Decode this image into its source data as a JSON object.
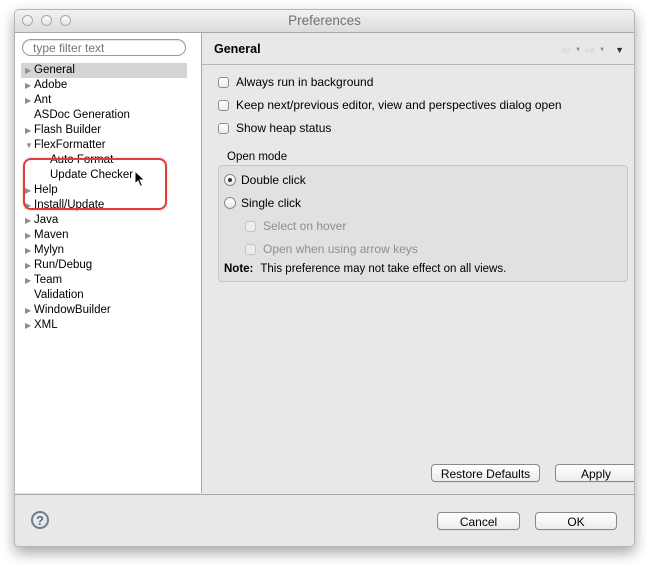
{
  "window": {
    "title": "Preferences"
  },
  "sidebar": {
    "filter": {
      "placeholder": "type filter text",
      "value": ""
    },
    "items": [
      {
        "label": "General",
        "expandable": true,
        "expanded": false,
        "selected": true,
        "level": 0
      },
      {
        "label": "Adobe",
        "expandable": true,
        "expanded": false,
        "level": 0
      },
      {
        "label": "Ant",
        "expandable": true,
        "expanded": false,
        "level": 0
      },
      {
        "label": "ASDoc Generation",
        "expandable": false,
        "level": 0
      },
      {
        "label": "Flash Builder",
        "expandable": true,
        "expanded": false,
        "level": 0
      },
      {
        "label": "FlexFormatter",
        "expandable": true,
        "expanded": true,
        "level": 0
      },
      {
        "label": "Auto Format",
        "expandable": false,
        "level": 1
      },
      {
        "label": "Update Checker",
        "expandable": false,
        "level": 1
      },
      {
        "label": "Help",
        "expandable": true,
        "expanded": false,
        "level": 0
      },
      {
        "label": "Install/Update",
        "expandable": true,
        "expanded": false,
        "level": 0
      },
      {
        "label": "Java",
        "expandable": true,
        "expanded": false,
        "level": 0
      },
      {
        "label": "Maven",
        "expandable": true,
        "expanded": false,
        "level": 0
      },
      {
        "label": "Mylyn",
        "expandable": true,
        "expanded": false,
        "level": 0
      },
      {
        "label": "Run/Debug",
        "expandable": true,
        "expanded": false,
        "level": 0
      },
      {
        "label": "Team",
        "expandable": true,
        "expanded": false,
        "level": 0
      },
      {
        "label": "Validation",
        "expandable": false,
        "level": 0
      },
      {
        "label": "WindowBuilder",
        "expandable": true,
        "expanded": false,
        "level": 0
      },
      {
        "label": "XML",
        "expandable": true,
        "expanded": false,
        "level": 0
      }
    ],
    "highlight_color": "#e03c3c"
  },
  "main": {
    "title": "General",
    "nav": {
      "back_icon": "arrow-left-icon",
      "forward_icon": "arrow-right-icon",
      "menu_icon": "triangle-down-icon"
    },
    "options": [
      {
        "label": "Always run in background",
        "checked": false
      },
      {
        "label": "Keep next/previous editor, view and perspectives dialog open",
        "checked": false
      },
      {
        "label": "Show heap status",
        "checked": false
      }
    ],
    "open_mode": {
      "label": "Open mode",
      "radios": [
        {
          "label": "Double click",
          "selected": true
        },
        {
          "label": "Single click",
          "selected": false
        }
      ],
      "sub_options": [
        {
          "label": "Select on hover",
          "checked": false,
          "enabled": false
        },
        {
          "label": "Open when using arrow keys",
          "checked": false,
          "enabled": false
        }
      ],
      "note_label": "Note:",
      "note_text": "This preference may not take effect on all views."
    },
    "restore_defaults_label": "Restore Defaults",
    "apply_label": "Apply"
  },
  "footer": {
    "help_glyph": "?",
    "cancel_label": "Cancel",
    "ok_label": "OK"
  }
}
